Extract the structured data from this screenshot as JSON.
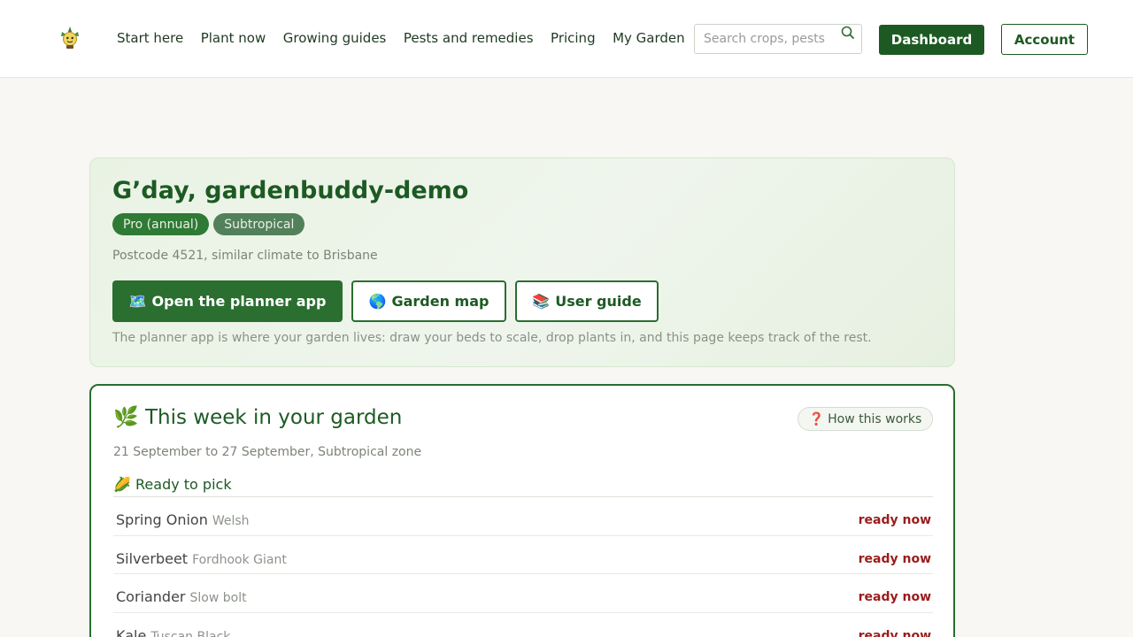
{
  "header": {
    "logo_icon": "plant-mascot-icon",
    "nav": [
      "Start here",
      "Plant now",
      "Growing guides",
      "Pests and remedies",
      "Pricing",
      "My Garden"
    ],
    "search_placeholder": "Search crops, pests",
    "search_icon": "search-icon",
    "dashboard_label": "Dashboard",
    "account_label": "Account"
  },
  "hero": {
    "greeting": "G’day, gardenbuddy-demo",
    "badges": [
      "Pro (annual)",
      "Subtropical"
    ],
    "postcode_text": "Postcode 4521, similar climate to Brisbane",
    "buttons": {
      "planner": {
        "emoji": "🗺️",
        "label": "Open the planner app"
      },
      "map": {
        "emoji": "🌎",
        "label": "Garden map"
      },
      "guide": {
        "emoji": "📚",
        "label": "User guide"
      }
    },
    "note": "The planner app is where your garden lives: draw your beds to scale, drop plants in, and this page keeps track of the rest."
  },
  "week": {
    "title_emoji": "🌿",
    "title": "This week in your garden",
    "how_emoji": "❓",
    "how_label": "How this works",
    "date_range": "21 September to 27 September, Subtropical zone",
    "section_emoji": "🌽",
    "section_title": "Ready to pick",
    "rows": [
      {
        "crop": "Spring Onion",
        "variety": "Welsh",
        "status": "ready now"
      },
      {
        "crop": "Silverbeet",
        "variety": "Fordhook Giant",
        "status": "ready now"
      },
      {
        "crop": "Coriander",
        "variety": "Slow bolt",
        "status": "ready now"
      },
      {
        "crop": "Kale",
        "variety": "Tuscan Black",
        "status": "ready now"
      }
    ]
  },
  "colors": {
    "brand_green": "#1d5a23",
    "accent_green": "#2a6e30",
    "status_red": "#9b1c1c",
    "page_bg": "#f8f7f3"
  }
}
